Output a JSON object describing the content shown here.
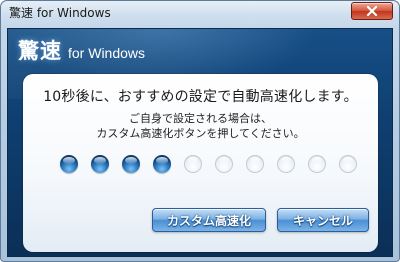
{
  "window": {
    "title": "驚速 for Windows",
    "close_icon": "close-icon"
  },
  "brand": {
    "main": "驚速",
    "sub": "for Windows"
  },
  "message": {
    "headline": "10秒後に、おすすめの設定で自動高速化します。",
    "line1": "ご自身で設定される場合は、",
    "line2": "カスタム高速化ボタンを押してください。"
  },
  "countdown": {
    "total_steps": 10,
    "completed_steps": 4
  },
  "buttons": {
    "custom_label": "カスタム高速化",
    "cancel_label": "キャンセル"
  },
  "colors": {
    "brand_panel": "#164f86",
    "button_blue": "#4a8fd3",
    "dot_active": "#2c7cc4",
    "close_red": "#c2351c"
  }
}
